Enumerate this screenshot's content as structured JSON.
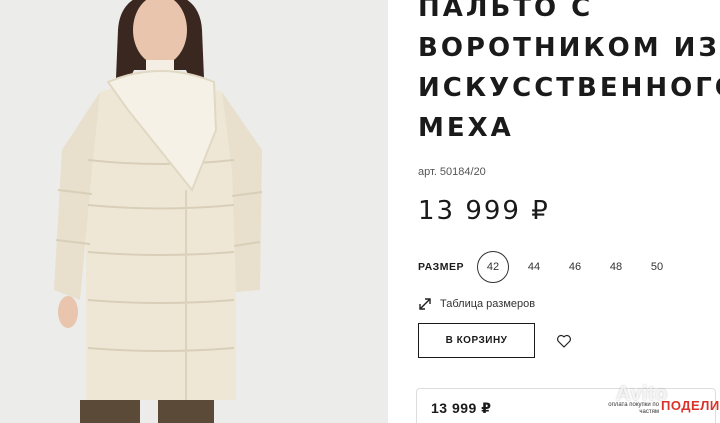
{
  "product": {
    "title_lines": [
      "ПАЛЬТО С",
      "ВОРОТНИКОМ ИЗ",
      "ИСКУССТВЕННОГО",
      "МЕХА"
    ],
    "sku": "арт. 50184/20",
    "price": "13 999 ₽"
  },
  "sizes": {
    "label": "РАЗМЕР",
    "options": [
      "42",
      "44",
      "46",
      "48",
      "50"
    ],
    "selected": "42"
  },
  "size_table": {
    "label": "Таблица размеров",
    "icon": "resize-arrows-icon"
  },
  "cart": {
    "label": "В КОРЗИНУ"
  },
  "favorite": {
    "icon": "heart-icon"
  },
  "bottom_bar": {
    "price": "13 999 ₽",
    "installments_text": "оплата покупки по частям",
    "brand": "ПОДЕЛИ"
  },
  "watermark": "Avito",
  "colors": {
    "coat": "#efe7d6",
    "background": "#ededeb",
    "accent_red": "#d8322a"
  }
}
